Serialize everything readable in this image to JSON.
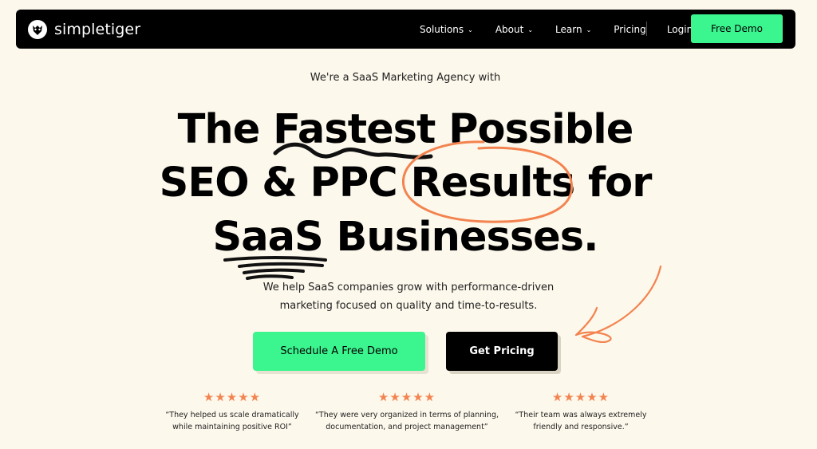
{
  "nav": {
    "logo_text": "simpletiger",
    "items": [
      {
        "label": "Solutions",
        "has_dropdown": true
      },
      {
        "label": "About",
        "has_dropdown": true
      },
      {
        "label": "Learn",
        "has_dropdown": true
      },
      {
        "label": "Pricing",
        "has_dropdown": false
      }
    ],
    "login_label": "Login",
    "cta_label": "Free Demo"
  },
  "hero": {
    "eyebrow": "We're a SaaS Marketing Agency with",
    "headline_line1": "The Fastest Possible",
    "headline_line2": "SEO & PPC Results for",
    "headline_line3": "SaaS Businesses.",
    "subtext_line1": "We help SaaS companies grow with performance-driven",
    "subtext_line2": "marketing focused on quality and time-to-results.",
    "primary_button": "Schedule A Free Demo",
    "secondary_button": "Get Pricing"
  },
  "reviews": [
    {
      "stars": "★★★★★",
      "line1": "“They helped us scale dramatically",
      "line2": "while maintaining positive ROI”"
    },
    {
      "stars": "★★★★★",
      "line1": "“They were very organized in terms of planning,",
      "line2": "documentation, and project management”"
    },
    {
      "stars": "★★★★★",
      "line1": "“Their team was always extremely",
      "line2": "friendly and responsive.”"
    }
  ],
  "colors": {
    "background": "#fdf8ec",
    "accent_green": "#3bf58f",
    "accent_orange": "#f3834f",
    "nav_bg": "#000000"
  },
  "icons": {
    "logo": "tiger-logo-icon",
    "dropdown": "chevron-down-icon",
    "rating": "star-icon"
  }
}
